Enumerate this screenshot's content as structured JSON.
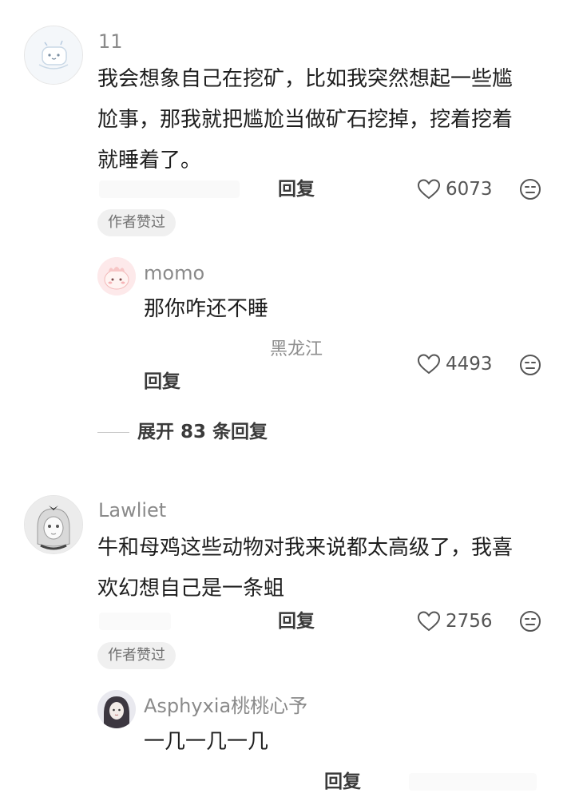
{
  "comments": [
    {
      "username": "11",
      "text_lines": [
        "我会想象自己在挖矿，比如我突然想起一些尴",
        "尬事，那我就把尴尬当做矿石挖掉，挖着挖着",
        "就睡着了。"
      ],
      "reply_label": "回复",
      "likes": "6073",
      "badge": "作者赞过",
      "replies": [
        {
          "username": "momo",
          "text": "那你咋还不睡",
          "location": "黑龙江",
          "reply_label": "回复",
          "likes": "4493"
        }
      ],
      "expand_label": "展开 83 条回复"
    },
    {
      "username": "Lawliet",
      "text_lines": [
        "牛和母鸡这些动物对我来说都太高级了，我喜",
        "欢幻想自己是一条蛆"
      ],
      "reply_label": "回复",
      "likes": "2756",
      "badge": "作者赞过",
      "replies": [
        {
          "username": "Asphyxia桃桃心予",
          "text": "一几一几一几",
          "reply_label": "回复"
        }
      ]
    }
  ],
  "icons": {
    "like": "heart-outline-icon",
    "emoji": "emoji-react-icon"
  }
}
